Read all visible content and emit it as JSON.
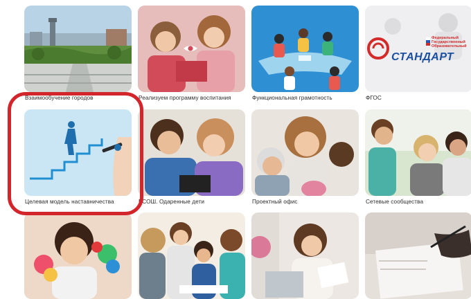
{
  "tiles": [
    {
      "caption": "Взаимообучение городов"
    },
    {
      "caption": "Реализуем программу воспитания"
    },
    {
      "caption": "Функциональная грамотность"
    },
    {
      "caption": "ФГОС"
    },
    {
      "caption": "Целевая модель наставничества"
    },
    {
      "caption": "ВСОШ. Одаренные дети"
    },
    {
      "caption": "Проектный офис"
    },
    {
      "caption": "Сетевые сообщества"
    },
    {
      "caption": ""
    },
    {
      "caption": ""
    },
    {
      "caption": ""
    },
    {
      "caption": ""
    }
  ],
  "fgos_logo": {
    "word": "СТАНДАРТ",
    "line1": "Федеральный",
    "line2": "Государственный",
    "line3": "Образовательный"
  },
  "colors": {
    "highlight": "#d3262c",
    "fgos_blue": "#1b4fa0",
    "fgos_red": "#d32a2a",
    "mentoring_blue": "#1f8fd1"
  },
  "icons": {
    "preview": "eye-icon"
  }
}
